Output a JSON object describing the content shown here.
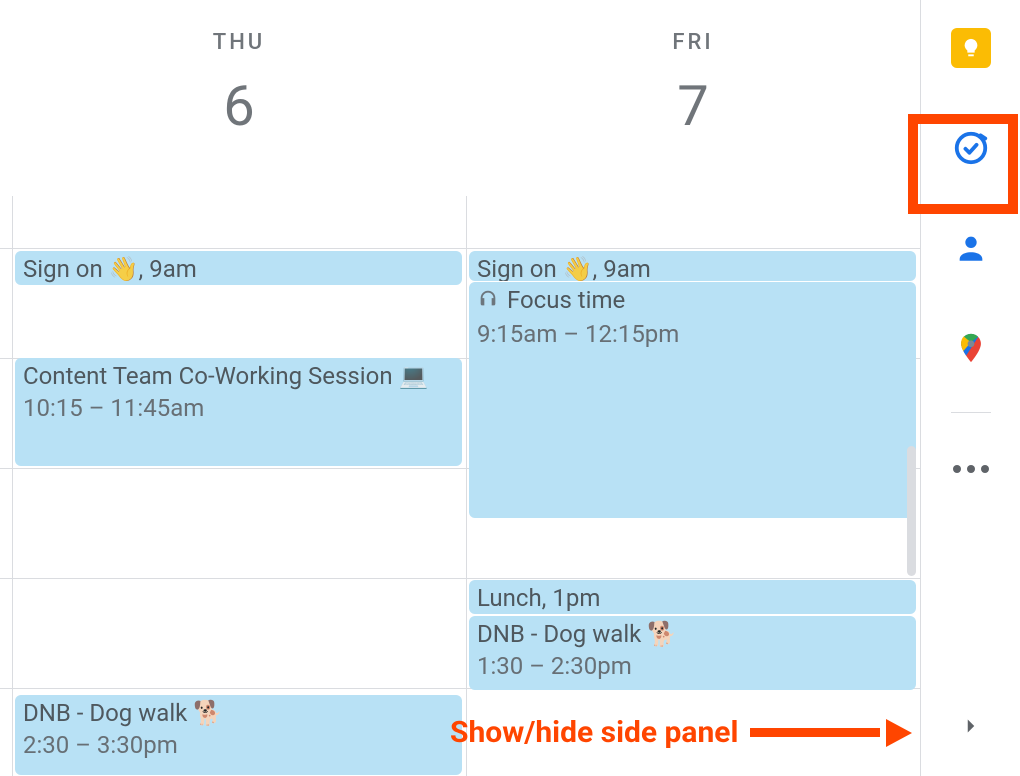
{
  "days": [
    {
      "dow": "THU",
      "num": "6"
    },
    {
      "dow": "FRI",
      "num": "7"
    }
  ],
  "events": {
    "thu_signon": {
      "title": "Sign on 👋, 9am"
    },
    "thu_cowork": {
      "title": "Content Team Co-Working Session 💻",
      "time": "10:15 – 11:45am"
    },
    "thu_dog": {
      "title": "DNB - Dog walk 🐕",
      "time": "2:30 – 3:30pm"
    },
    "fri_signon": {
      "title": "Sign on 👋, 9am"
    },
    "fri_focus": {
      "title": "Focus time",
      "time": "9:15am – 12:15pm"
    },
    "fri_lunch": {
      "title": "Lunch, 1pm"
    },
    "fri_dog": {
      "title": "DNB - Dog walk 🐕",
      "time": "1:30 – 2:30pm"
    }
  },
  "rail": {
    "keep": "keep-icon",
    "tasks": "tasks-icon",
    "contacts": "contacts-icon",
    "maps": "maps-icon",
    "more": "more-addons",
    "toggle": "show-hide-side-panel"
  },
  "annotation": {
    "text": "Show/hide side panel"
  }
}
